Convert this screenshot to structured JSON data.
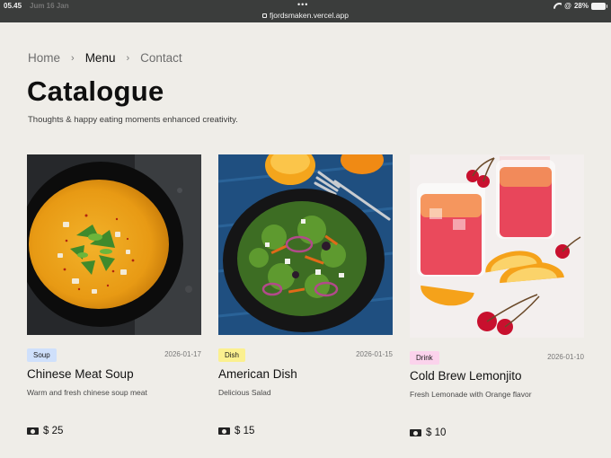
{
  "status_bar": {
    "time": "05.45",
    "date": "Jum 16 Jan",
    "url": "fjordsmaken.vercel.app",
    "battery": "28%",
    "icons": [
      "wifi-icon",
      "at-icon",
      "battery-icon"
    ]
  },
  "breadcrumb": {
    "items": [
      "Home",
      "Menu",
      "Contact"
    ],
    "active": "Menu"
  },
  "page": {
    "title": "Catalogue",
    "subtitle": "Thoughts & happy eating moments enhanced creativity."
  },
  "cards": [
    {
      "badge": "Soup",
      "badge_color": "#cfe0fb",
      "date": "2026-01-17",
      "name": "Chinese Meat Soup",
      "description": "Warm and fresh chinese soup meat",
      "price": "$ 25",
      "image": "soup-image"
    },
    {
      "badge": "Dish",
      "badge_color": "#fbf08f",
      "date": "2026-01-15",
      "name": "American Dish",
      "description": "Delicious Salad",
      "price": "$ 15",
      "image": "salad-image"
    },
    {
      "badge": "Drink",
      "badge_color": "#fbd3ec",
      "date": "2026-01-10",
      "name": "Cold Brew Lemonjito",
      "description": "Fresh Lemonade with Orange flavor",
      "price": "$ 10",
      "image": "drink-image"
    }
  ]
}
